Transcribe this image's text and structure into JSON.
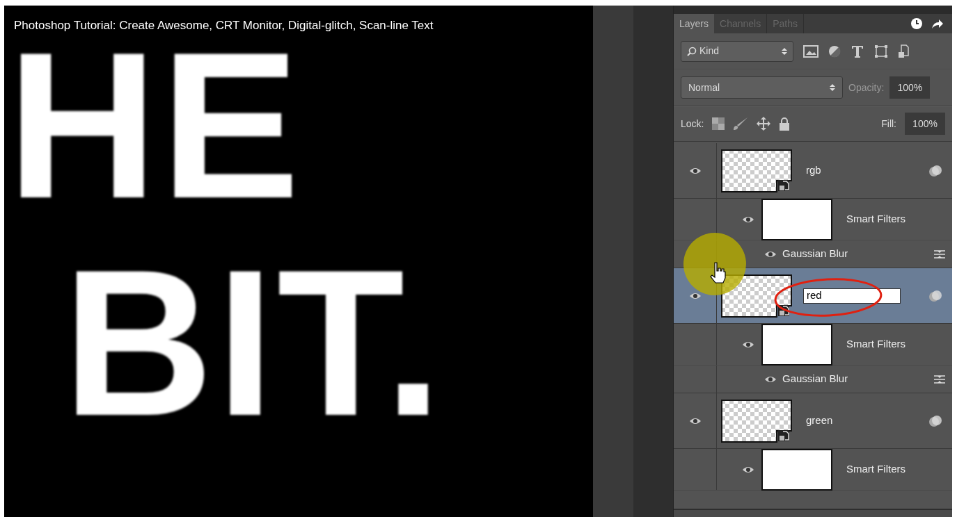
{
  "video_title": "Photoshop Tutorial: Create Awesome, CRT Monitor, Digital-glitch, Scan-line Text",
  "canvas_texts": [
    "HE",
    "BIT."
  ],
  "layers_panel": {
    "tabs": [
      {
        "label": "Layers",
        "selected": true
      },
      {
        "label": "Channels",
        "selected": false
      },
      {
        "label": "Paths",
        "selected": false
      }
    ],
    "filter": "Kind",
    "blend_mode": "Normal",
    "opacity_label": "Opacity:",
    "opacity": "100%",
    "lock_label": "Lock:",
    "fill_label": "Fill:",
    "fill": "100%",
    "layers": [
      {
        "name": "rgb",
        "selected": false,
        "editing": false,
        "children": [
          {
            "kind": "mask",
            "label": "Smart Filters"
          },
          {
            "kind": "filter",
            "label": "Gaussian Blur"
          }
        ]
      },
      {
        "name": "red",
        "selected": true,
        "editing": true,
        "children": [
          {
            "kind": "mask",
            "label": "Smart Filters"
          },
          {
            "kind": "filter",
            "label": "Gaussian Blur"
          }
        ]
      },
      {
        "name": "green",
        "selected": false,
        "editing": false,
        "children": [
          {
            "kind": "mask",
            "label": "Smart Filters"
          }
        ]
      }
    ]
  }
}
